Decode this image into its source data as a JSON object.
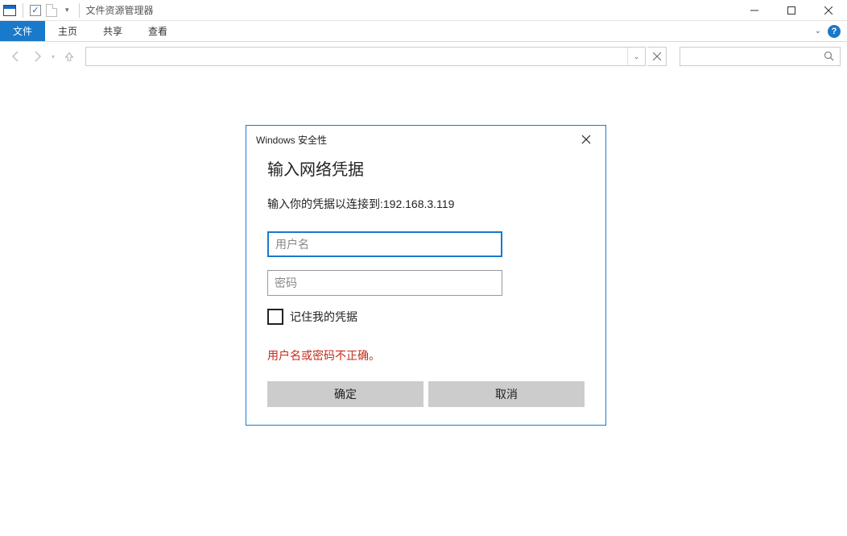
{
  "titlebar": {
    "app_title": "文件资源管理器"
  },
  "ribbon": {
    "file": "文件",
    "home": "主页",
    "share": "共享",
    "view": "查看"
  },
  "dialog": {
    "window_title": "Windows 安全性",
    "heading": "输入网络凭据",
    "subtitle": "输入你的凭据以连接到:192.168.3.119",
    "username_placeholder": "用户名",
    "password_placeholder": "密码",
    "remember_label": "记住我的凭据",
    "error": "用户名或密码不正确。",
    "ok": "确定",
    "cancel": "取消"
  }
}
